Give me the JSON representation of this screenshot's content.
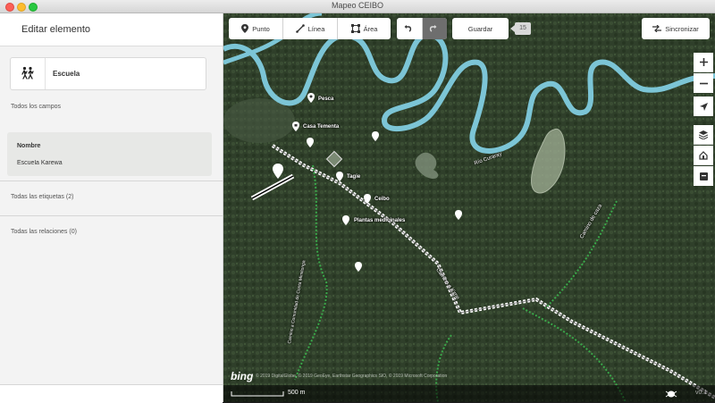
{
  "window": {
    "title": "Mapeo CEIBO"
  },
  "sidebar": {
    "header_title": "Editar elemento",
    "preset": {
      "icon": "school-children-icon",
      "name": "Escuela"
    },
    "all_fields_label": "Todos los campos",
    "field": {
      "label": "Nombre",
      "value": "Escuela Karewa"
    },
    "all_tags_label": "Todas las etiquetas (2)",
    "all_relations_label": "Todas las relaciones (0)"
  },
  "toolbar": {
    "modes": [
      {
        "label": "Punto",
        "icon": "map-pin-icon"
      },
      {
        "label": "Línea",
        "icon": "line-icon"
      },
      {
        "label": "Área",
        "icon": "area-icon"
      }
    ],
    "undo_icon": "undo-icon",
    "redo_icon": "redo-icon",
    "save_label": "Guardar",
    "edit_count": "15",
    "sync_label": "Sincronizar",
    "sync_icon": "sync-arrows-icon"
  },
  "map_controls": [
    "zoom-in-icon",
    "zoom-out-icon",
    "geolocate-icon",
    "layers-icon",
    "map-data-icon",
    "history-icon"
  ],
  "map": {
    "labels": {
      "pesca": "Pesca",
      "casa": "Casa Tementa",
      "tagie": "Tagie",
      "ceibo": "Ceibo",
      "plantas": "Plantas medicinales",
      "river": "Río Curaray",
      "trail1": "Camino de caza",
      "trail2": "Camino a Kime",
      "trail3": "Camino a Comunidad de Conta Mimitonga"
    },
    "scale_label": "500 m",
    "imagery_brand": "bing",
    "attribution": "© 2019 DigitalGlobe, © 2019 GeoEye, Earthstar Geographics SIO, © 2019 Microsoft Corporation",
    "footer_right": "v0.1"
  },
  "colors": {
    "river": "#7cc5d6",
    "trail": "#ffffff",
    "path_green": "#3aa84a",
    "forest": "#304029"
  }
}
